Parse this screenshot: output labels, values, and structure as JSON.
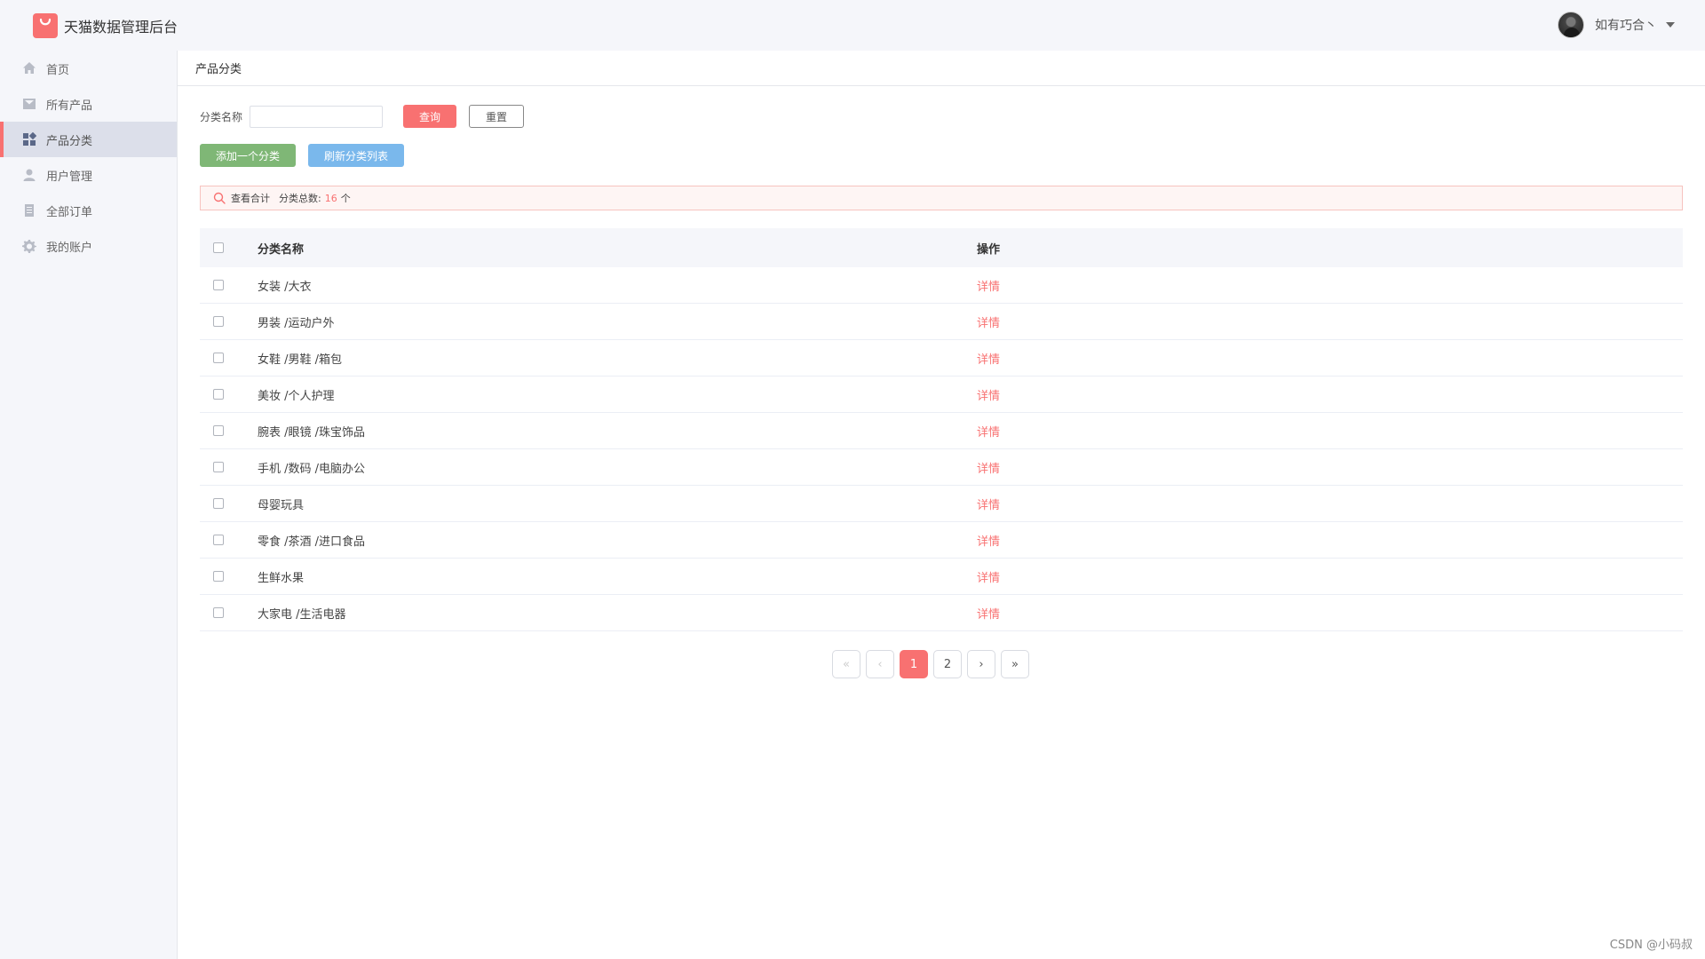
{
  "header": {
    "brand_title": "天猫数据管理后台",
    "user_name": "如有巧合丶"
  },
  "sidebar": {
    "items": [
      {
        "label": "首页",
        "icon": "home-icon"
      },
      {
        "label": "所有产品",
        "icon": "product-icon"
      },
      {
        "label": "产品分类",
        "icon": "category-icon",
        "active": true
      },
      {
        "label": "用户管理",
        "icon": "user-icon"
      },
      {
        "label": "全部订单",
        "icon": "order-icon"
      },
      {
        "label": "我的账户",
        "icon": "gear-icon"
      }
    ]
  },
  "page": {
    "title": "产品分类"
  },
  "search": {
    "label": "分类名称",
    "value": "",
    "query_button": "查询",
    "reset_button": "重置"
  },
  "actions": {
    "add_button": "添加一个分类",
    "refresh_button": "刷新分类列表"
  },
  "summary": {
    "title": "查看合计",
    "total_label": "分类总数:",
    "total_count": "16",
    "unit": "个"
  },
  "table": {
    "columns": [
      "分类名称",
      "操作"
    ],
    "rows": [
      {
        "name": "女装 /大衣",
        "action": "详情"
      },
      {
        "name": "男装 /运动户外",
        "action": "详情"
      },
      {
        "name": "女鞋 /男鞋 /箱包",
        "action": "详情"
      },
      {
        "name": "美妆 /个人护理",
        "action": "详情"
      },
      {
        "name": "腕表 /眼镜 /珠宝饰品",
        "action": "详情"
      },
      {
        "name": "手机 /数码 /电脑办公",
        "action": "详情"
      },
      {
        "name": "母婴玩具",
        "action": "详情"
      },
      {
        "name": "零食 /茶酒 /进口食品",
        "action": "详情"
      },
      {
        "name": "生鲜水果",
        "action": "详情"
      },
      {
        "name": "大家电 /生活电器",
        "action": "详情"
      }
    ]
  },
  "pagination": {
    "first": "«",
    "prev": "‹",
    "pages": [
      "1",
      "2"
    ],
    "current": "1",
    "next": "›",
    "last": "»"
  },
  "watermark": "CSDN @小码叔",
  "colors": {
    "accent": "#f87171",
    "add_button": "#7fb776",
    "refresh_button": "#7ab8ec",
    "sidebar_bg": "#f5f6fa",
    "active_nav_bg": "#dcdfea"
  }
}
